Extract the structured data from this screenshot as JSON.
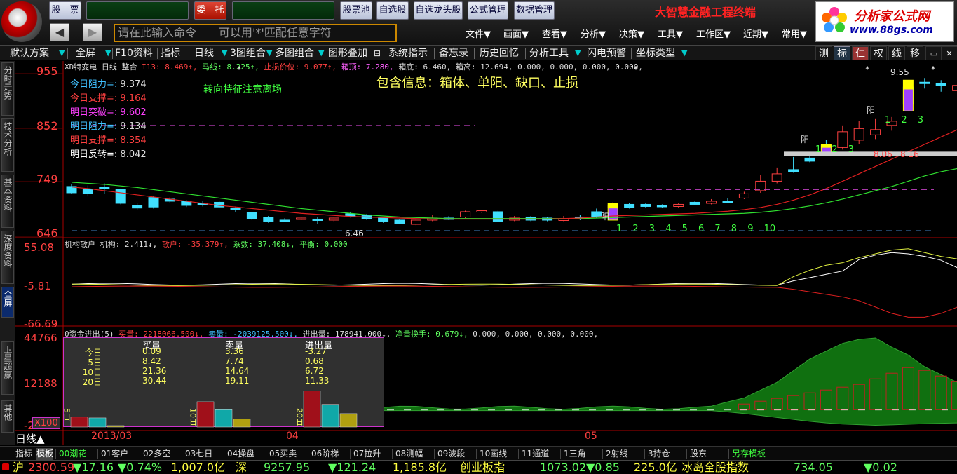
{
  "top": {
    "buttons": [
      "股　票",
      "委　托",
      "股票池",
      "自选股",
      "自选龙头股",
      "公式管理",
      "数据管理"
    ],
    "app_title": "大智慧金融工程终端",
    "brand_title": "分析家公式网",
    "brand_url": "www.88gs.com",
    "command_placeholder": "请在此输入命令　　可以用'*'匹配任意字符",
    "menus": [
      "文件▼",
      "画面▼",
      "查看▼",
      "分析▼",
      "决策▼",
      "工具▼",
      "工作区▼",
      "近期▼",
      "常用▼"
    ]
  },
  "toolbar": {
    "items": [
      "默认方案",
      "▼",
      "全屏",
      "▼",
      "F10资料",
      "指标",
      "日线",
      "▼",
      "3图组合",
      "▼",
      "多图组合",
      "▼",
      "图形叠加",
      "系统指示",
      "备忘录",
      "历史回忆",
      "分析工具",
      "▼",
      "闪电预警",
      "坐标类型",
      "▼"
    ],
    "right": [
      "测",
      "标",
      "仁",
      "权",
      "线",
      "移"
    ]
  },
  "sidebar": [
    "分时走势",
    "技术分析",
    "基本资料",
    "深度资料",
    "全屏",
    "卫星超赢",
    "其他"
  ],
  "main_chart": {
    "info_line": [
      {
        "t": "XD特变电",
        "c": "#ddd"
      },
      {
        "t": "日线",
        "c": "#ddd"
      },
      {
        "t": "整合",
        "c": "#ddd"
      },
      {
        "t": "I13: 8.469↑,",
        "c": "#ff4040"
      },
      {
        "t": "马线: 8.225↑,",
        "c": "#60ff60"
      },
      {
        "t": "止损价位: 9.077↑,",
        "c": "#ff4040"
      },
      {
        "t": "箱顶: 7.280,",
        "c": "#ff60ff"
      },
      {
        "t": "箱底: 6.460,",
        "c": "#ddd"
      },
      {
        "t": "箱高: 12.694, 0.000, 0.000, 0.000, 0.000,",
        "c": "#ddd"
      }
    ],
    "y_labels": [
      "955",
      "852",
      "749",
      "646"
    ],
    "levels": [
      {
        "label": "今日阻力=:",
        "value": "9.374",
        "color": "#40c0ff"
      },
      {
        "label": "今日支撑=:",
        "value": "9.164",
        "color": "#ff4040"
      },
      {
        "label": "明日突破=:",
        "value": "9.602",
        "color": "#ff40ff"
      },
      {
        "label": "明日阻力=:",
        "value": "9.134",
        "color": "#40c0ff"
      },
      {
        "label": "明日支撑=:",
        "value": "8.354",
        "color": "#ff4040"
      },
      {
        "label": "明日反转=:",
        "value": "8.042",
        "color": "#ffffff"
      }
    ],
    "note_green": "转向特征注意离场",
    "note_yellow": "包含信息：箱体、单阳、缺口、止损",
    "annotations": {
      "low": "6.46",
      "high": "9.55",
      "yang1": "阳",
      "yang2": "阳",
      "yang3": "阳",
      "v1": "8.06",
      "v2": "8.16"
    },
    "count_labels": [
      "1",
      "2",
      "3",
      "4",
      "5",
      "6",
      "7",
      "8",
      "9",
      "10"
    ],
    "count_labels2": [
      "1",
      "2",
      "3"
    ],
    "count_labels3": [
      "1",
      "2",
      "3"
    ]
  },
  "sub1": {
    "title": "机构散户",
    "info": [
      {
        "t": "机构: 2.411↓,",
        "c": "#ddd"
      },
      {
        "t": "散户: -35.379↑,",
        "c": "#ff4040"
      },
      {
        "t": "系数: 37.408↓,",
        "c": "#60ff60"
      },
      {
        "t": "平衡: 0.000",
        "c": "#60ff60"
      }
    ],
    "y_labels": [
      "55.08",
      "-5.81",
      "-66.69"
    ]
  },
  "sub2": {
    "title": "0资金进出(5)",
    "info": [
      {
        "t": "买量: 2218066.500↓,",
        "c": "#ff4040"
      },
      {
        "t": "卖量: -2039125.500↓,",
        "c": "#40c0ff"
      },
      {
        "t": "进出量: 178941.000↓,",
        "c": "#ddd"
      },
      {
        "t": "净量换手: 0.679↓,",
        "c": "#60ff60"
      },
      {
        "t": "0.000, 0.000, 0.000, 0.000,",
        "c": "#ddd"
      }
    ],
    "y_labels": [
      "44766",
      "12188",
      "-2"
    ],
    "x100": "X100",
    "table": {
      "headers": [
        "买量",
        "卖量",
        "进出量"
      ],
      "rows": [
        {
          "label": "今日",
          "v": [
            "0.09",
            "3.36",
            "-3.27"
          ]
        },
        {
          "label": "5日",
          "v": [
            "8.42",
            "7.74",
            "0.68"
          ]
        },
        {
          "label": "10日",
          "v": [
            "21.36",
            "14.64",
            "6.72"
          ]
        },
        {
          "label": "20日",
          "v": [
            "30.44",
            "19.11",
            "11.33"
          ]
        }
      ],
      "bar_groups": [
        "5日",
        "10日",
        "20日"
      ]
    }
  },
  "x_axis": [
    "2013/03",
    "04",
    "05"
  ],
  "period": "日线▲",
  "bottom_tabs": [
    "指标",
    "模板",
    "00潮花",
    "01客户",
    "02多空",
    "03七日",
    "04操盘",
    "05买卖",
    "06阶梯",
    "07拉升",
    "08测幅",
    "09波段",
    "10画线",
    "11通道",
    "1三角",
    "2射线",
    "3持仓",
    "股东",
    "另存模板"
  ],
  "status": [
    {
      "t": "沪",
      "c": "#ffff40"
    },
    {
      "t": "2300.59",
      "c": "#ff4040"
    },
    {
      "t": "▼17.16",
      "c": "#60ff60"
    },
    {
      "t": "▼0.74%",
      "c": "#60ff60"
    },
    {
      "t": "1,007.0亿",
      "c": "#ffff40"
    },
    {
      "t": "深",
      "c": "#ffff40"
    },
    {
      "t": "9257.95",
      "c": "#60ff60"
    },
    {
      "t": "▼121.24",
      "c": "#60ff60"
    },
    {
      "t": "1,185.8亿",
      "c": "#ffff40"
    },
    {
      "t": "创业板指",
      "c": "#ffff40"
    },
    {
      "t": "1073.02",
      "c": "#60ff60"
    },
    {
      "t": "▼0.85",
      "c": "#60ff60"
    },
    {
      "t": "225.0亿",
      "c": "#ffff40"
    },
    {
      "t": "冰岛全股指数",
      "c": "#ffff40"
    },
    {
      "t": "734.05",
      "c": "#60ff60"
    },
    {
      "t": "▼0.02",
      "c": "#60ff60"
    }
  ]
}
